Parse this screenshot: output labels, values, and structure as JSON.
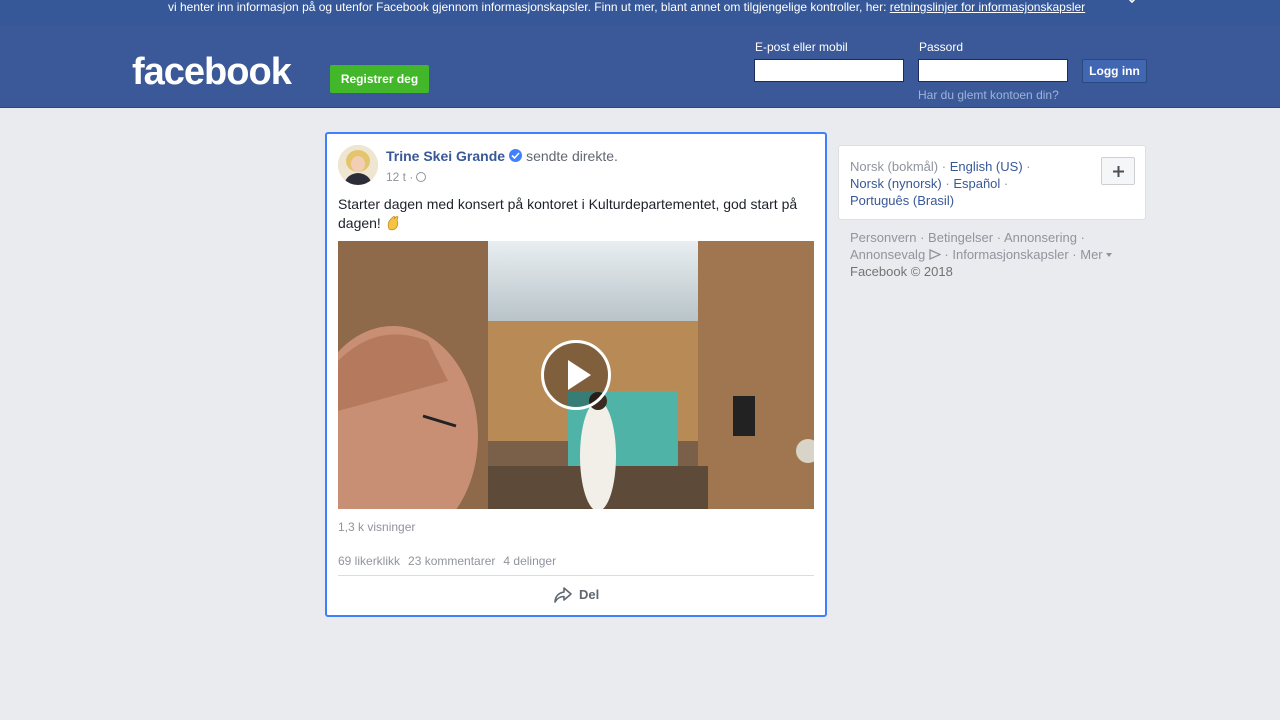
{
  "cookie_banner": {
    "text": "vi henter inn informasjon på og utenfor Facebook gjennom informasjonskapsler. Finn ut mer, blant annet om tilgjengelige kontroller, her: ",
    "link": "retningslinjer for informasjonskapsler"
  },
  "header": {
    "logo": "facebook",
    "register_label": "Registrer deg",
    "email_label": "E-post eller mobil",
    "password_label": "Passord",
    "login_label": "Logg inn",
    "forgot_link": "Har du glemt kontoen din?"
  },
  "post": {
    "author": "Trine Skei Grande",
    "action": "sendte direkte.",
    "time": "12 t ·",
    "text": "Starter dagen med konsert på kontoret i Kulturdepartementet, god start på dagen!",
    "views": "1,3 k visninger",
    "likes": "69 likerklikk",
    "comments": "23 kommentarer",
    "shares": "4 delinger",
    "share_label": "Del"
  },
  "languages": {
    "current": "Norsk (bokmål)",
    "items": [
      "English (US)",
      "Norsk (nynorsk)",
      "Español",
      "Português (Brasil)"
    ]
  },
  "footer": {
    "links": [
      "Personvern",
      "Betingelser",
      "Annonsering",
      "Annonsevalg",
      "Informasjonskapsler",
      "Mer"
    ],
    "copyright": "Facebook © 2018"
  },
  "colors": {
    "brand_blue": "#3b5998",
    "register_green": "#42b72a",
    "link_blue": "#385898",
    "focus_border": "#4080ff"
  }
}
